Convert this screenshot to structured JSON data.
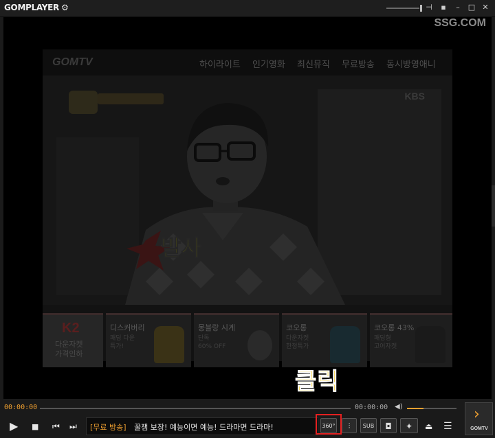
{
  "titlebar": {
    "app_name": "GOMPLAYER",
    "settings_icon": "gear-icon",
    "controls": [
      "pin-icon",
      "minimize-icon",
      "maximize-icon",
      "close-icon"
    ]
  },
  "video": {
    "watermark": "SSG.COM",
    "webpage": {
      "logo": "GOMTV",
      "nav": [
        "하이라이트",
        "인기영화",
        "최신뮤직",
        "무료방송",
        "동시방영애니"
      ],
      "broadcaster": "KBS",
      "caption": "발사",
      "ads": [
        {
          "brand": "K2",
          "lines": "다운자켓\n가격인하"
        },
        {
          "title": "디스커버리",
          "lines": "패딩 다운\n특가!"
        },
        {
          "title": "몽블랑 시계",
          "lines": "단독\n60% OFF"
        },
        {
          "title": "코오롱",
          "lines": "다운자켓\n한정특가"
        },
        {
          "title": "코오롱 43%",
          "lines": "패딩형\n고어자켓"
        }
      ]
    },
    "annotation": "클릭"
  },
  "seek": {
    "current_time": "00:00:00",
    "total_time": "00:00:00",
    "progress": 0,
    "volume": 0.33
  },
  "controls": {
    "ticker_tag": "[무료 방송]",
    "ticker_text": "꿀잼 보장! 예능이면 예능! 드라마면 드라마!",
    "btn_360": "360°",
    "btn_sub": "SUB",
    "gomtv_label": "GOMTV"
  },
  "colors": {
    "accent": "#f0a030",
    "highlight": "#e52020",
    "annotation": "#f5c400"
  }
}
